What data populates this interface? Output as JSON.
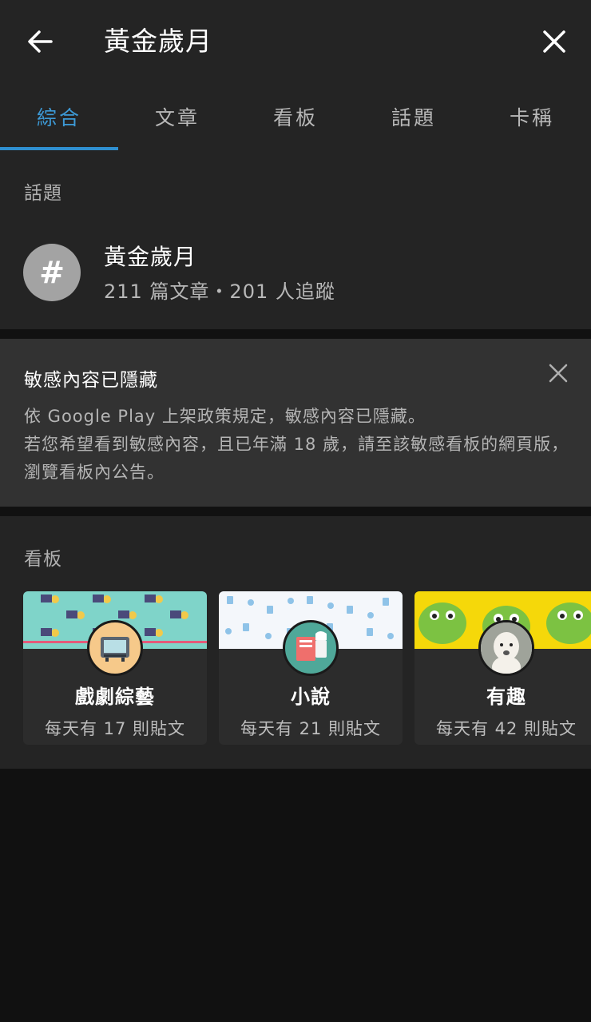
{
  "header": {
    "query": "黃金歲月",
    "back_icon": "arrow-left-icon",
    "close_icon": "close-icon"
  },
  "tabs": [
    {
      "label": "綜合",
      "active": true
    },
    {
      "label": "文章",
      "active": false
    },
    {
      "label": "看板",
      "active": false
    },
    {
      "label": "話題",
      "active": false
    },
    {
      "label": "卡稱",
      "active": false
    }
  ],
  "topics": {
    "section_label": "話題",
    "item": {
      "icon": "#",
      "name": "黃金歲月",
      "meta": "211 篇文章・201 人追蹤"
    }
  },
  "notice": {
    "title": "敏感內容已隱藏",
    "body_line1": "依 Google Play 上架政策規定，敏感內容已隱藏。",
    "body_line2": "若您希望看到敏感內容，且已年滿 18 歲，請至該敏感看板的網頁版，瀏覽看板內公告。"
  },
  "boards": {
    "section_label": "看板",
    "items": [
      {
        "name": "戲劇綜藝",
        "sub": "每天有 17 則貼文",
        "banner_color": "#7fd4c9",
        "avatar_icon": "tv-icon"
      },
      {
        "name": "小說",
        "sub": "每天有 21 則貼文",
        "banner_color": "#f4f7fb",
        "avatar_icon": "book-icon"
      },
      {
        "name": "有趣",
        "sub": "每天有 42 則貼文",
        "banner_color": "#f5d80a",
        "avatar_icon": "alpaca-icon"
      }
    ]
  },
  "colors": {
    "accent": "#2f8fd0",
    "surface": "#242424",
    "notice_bg": "#323232",
    "background": "#111111"
  }
}
